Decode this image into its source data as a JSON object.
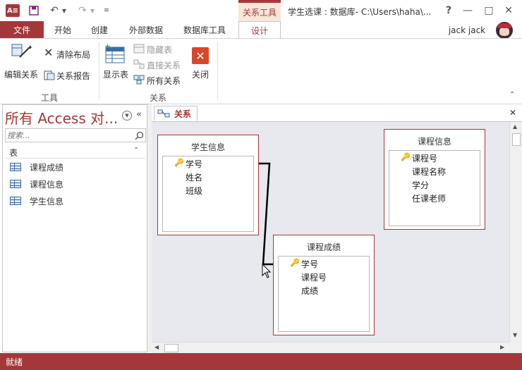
{
  "titlebar": {
    "app_icon": "A≡",
    "context_tab": "关系工具",
    "doc_title": "学生选课 : 数据库- C:\\Users\\haha\\...",
    "help": "?",
    "min": "—",
    "restore": "□",
    "close": "✕"
  },
  "tabs": {
    "file": "文件",
    "home": "开始",
    "create": "创建",
    "external": "外部数据",
    "dbtools": "数据库工具",
    "design": "设计",
    "user": "jack jack"
  },
  "ribbon": {
    "edit_rel": "编辑关系",
    "clear_layout": "清除布局",
    "rel_report": "关系报告",
    "group_tools": "工具",
    "show_table": "显示表",
    "hide_table": "隐藏表",
    "direct_rel": "直接关系",
    "all_rel": "所有关系",
    "close": "关闭",
    "group_rel": "关系"
  },
  "nav": {
    "title": "所有 Access 对...",
    "search_placeholder": "搜索...",
    "section": "表",
    "items": [
      "课程成绩",
      "课程信息",
      "学生信息"
    ]
  },
  "doc": {
    "tab_label": "关系"
  },
  "tables": {
    "student": {
      "title": "学生信息",
      "fields": [
        "学号",
        "姓名",
        "班级"
      ]
    },
    "course": {
      "title": "课程信息",
      "fields": [
        "课程号",
        "课程名称",
        "学分",
        "任课老师"
      ]
    },
    "score": {
      "title": "课程成绩",
      "fields": [
        "学号",
        "课程号",
        "成绩"
      ]
    }
  },
  "status": {
    "text": "就绪"
  },
  "colors": {
    "accent": "#a4373a",
    "canvas": "#e7e9ee"
  }
}
